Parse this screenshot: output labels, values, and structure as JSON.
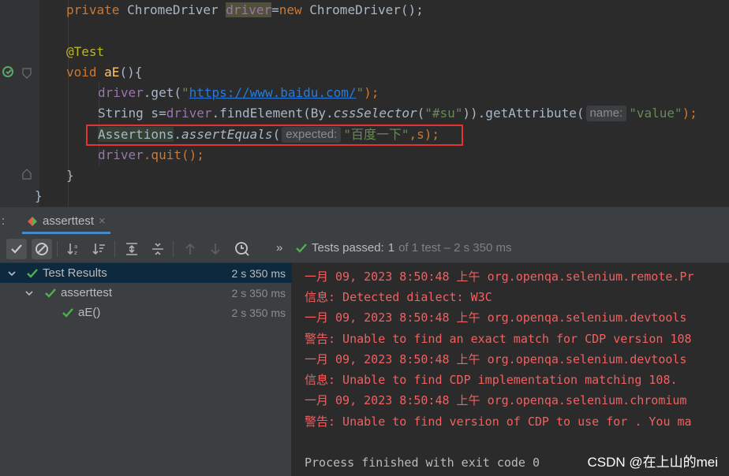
{
  "editor": {
    "line1": {
      "kw": "private",
      "type": " ChromeDriver ",
      "field": "driver",
      "eq": "=",
      "kw2": "new",
      "rest": " ChromeDriver();"
    },
    "line2": {
      "annotation": "@Test"
    },
    "line3": {
      "kw": "void",
      "method": "aE",
      "rest": "(){"
    },
    "line4": {
      "field": "driver",
      "call": ".get(",
      "url": "https://www.baidu.com/",
      "q1": "\"",
      "q2": "\"",
      "end": ");"
    },
    "line5": {
      "prefix": "String s=",
      "field": "driver",
      "call": ".findElement(By.",
      "method": "cssSelector",
      "open": "(",
      "str": "\"#su\"",
      "mid": ")).getAttribute(",
      "hint": "name:",
      "str2": "\"value\"",
      "end": ");"
    },
    "line6": {
      "cls": "Assertions",
      "dot": ".",
      "method": "assertEquals",
      "open": "(",
      "hint": "expected:",
      "str": "\"百度一下\"",
      "end": ",s);"
    },
    "line7": {
      "field": "driver",
      "rest": ".quit();"
    },
    "line8": {
      "text": "}"
    },
    "line9": {
      "text": "}"
    }
  },
  "tool_window": {
    "prefix": ":",
    "tab_label": "asserttest",
    "tab_close": "×"
  },
  "toolbar": {
    "buttons": [
      "show-passed-icon",
      "show-ignored-icon",
      "sort-alpha-icon",
      "sort-duration-icon",
      "expand-all-icon",
      "collapse-all-icon",
      "prev-fail-icon",
      "next-fail-icon",
      "test-history-icon"
    ]
  },
  "status": {
    "chevron": "»",
    "passed_label": "Tests passed:",
    "count": "1",
    "detail": "of 1 test – 2 s 350 ms"
  },
  "tree": {
    "rows": [
      {
        "name": "Test Results",
        "time": "2 s 350 ms"
      },
      {
        "name": "asserttest",
        "time": "2 s 350 ms"
      },
      {
        "name": "aE()",
        "time": "2 s 350 ms"
      }
    ]
  },
  "console": {
    "lines": [
      "一月 09, 2023 8:50:48 上午 org.openqa.selenium.remote.Pr",
      "信息: Detected dialect: W3C",
      "一月 09, 2023 8:50:48 上午 org.openqa.selenium.devtools",
      "警告: Unable to find an exact match for CDP version 108",
      "一月 09, 2023 8:50:48 上午 org.openqa.selenium.devtools",
      "信息: Unable to find CDP implementation matching 108.",
      "一月 09, 2023 8:50:48 上午 org.openqa.selenium.chromium",
      "警告: Unable to find version of CDP to use for . You ma",
      "",
      "Process finished with exit code 0"
    ]
  },
  "watermark": "CSDN @在上山的mei",
  "colors": {
    "editor_bg": "#2b2b2b",
    "panel_bg": "#3c3f41",
    "selection": "#0d293e",
    "pass_green": "#4fb04f",
    "error_red": "#f26060",
    "highlight_border": "#e53232"
  }
}
